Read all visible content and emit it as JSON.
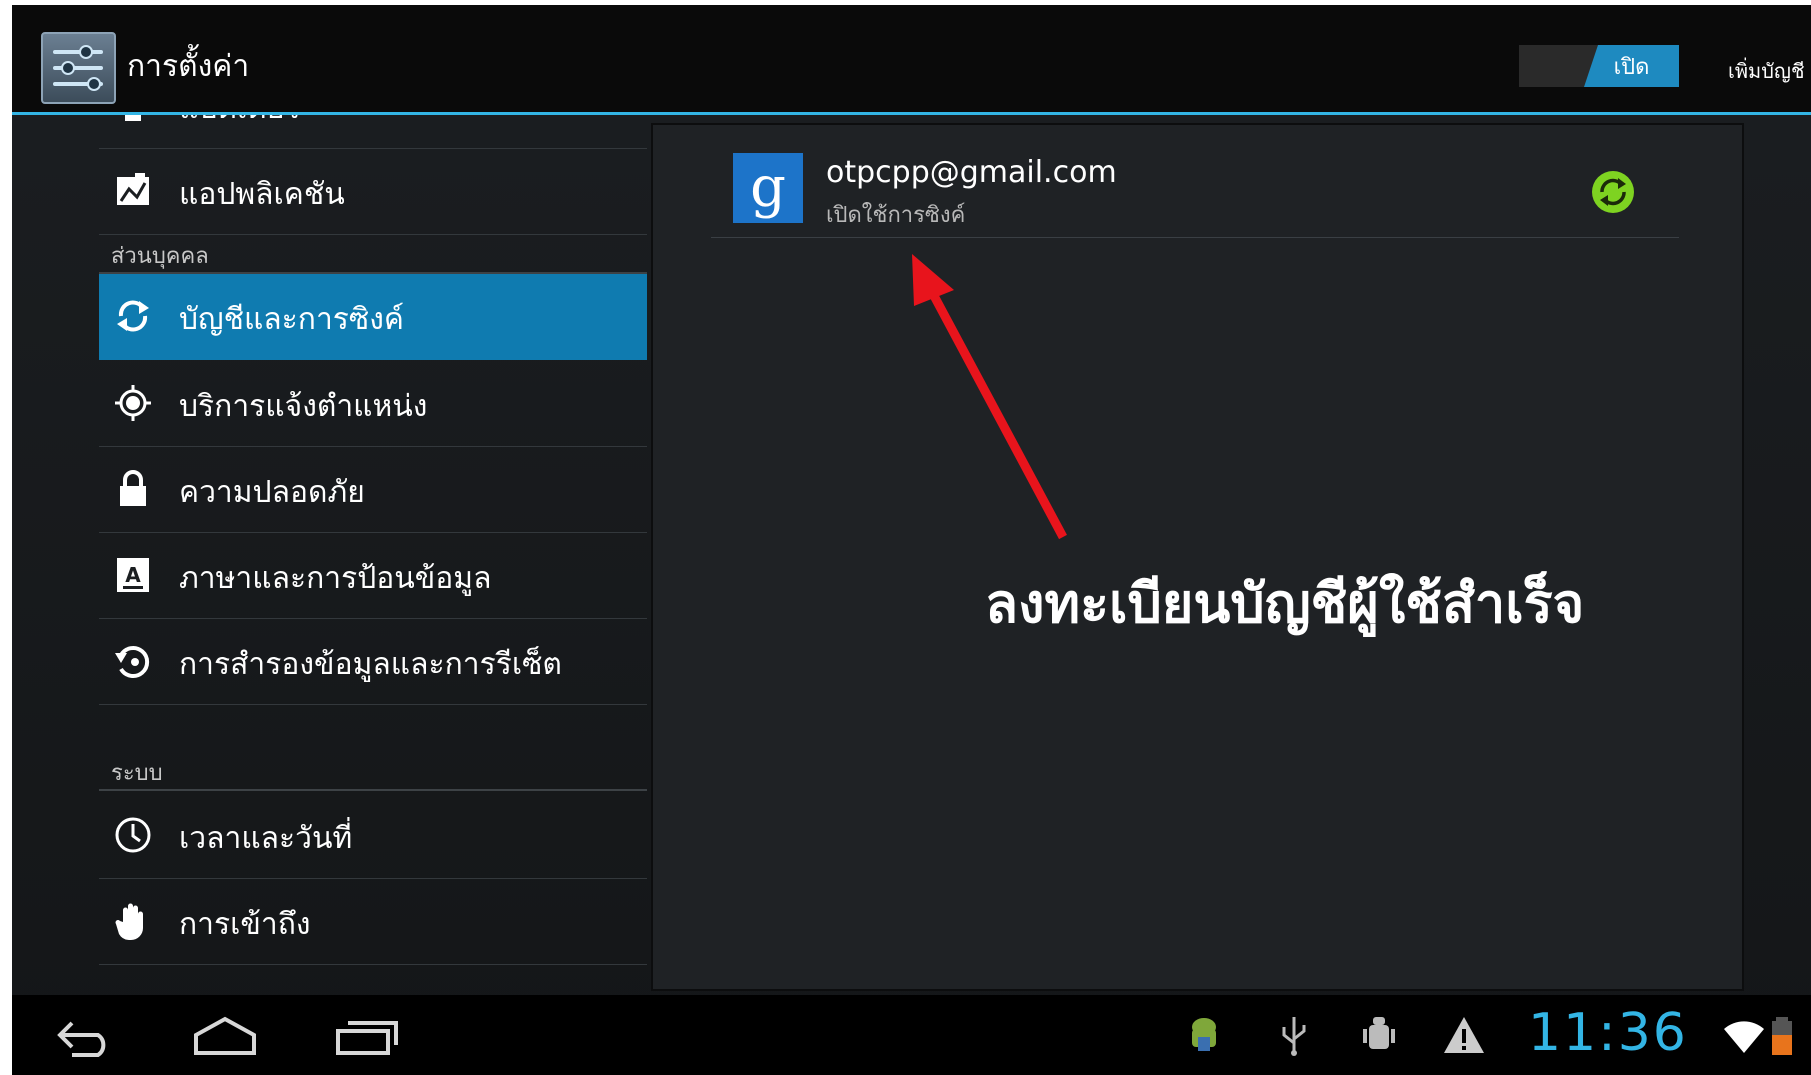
{
  "action_bar": {
    "title": "การตั้งค่า",
    "master_toggle_label": "เปิด",
    "add_account_label": "เพิ่มบัญชี"
  },
  "settings": {
    "partial_top_label": "แบตเตอรี่",
    "items_device": [
      {
        "label": "แอปพลิเคชัน",
        "icon": "apps-icon"
      }
    ],
    "section_personal": "ส่วนบุคคล",
    "items_personal": [
      {
        "label": "บัญชีและการซิงค์",
        "icon": "sync-icon",
        "selected": true
      },
      {
        "label": "บริการแจ้งตำแหน่ง",
        "icon": "location-icon"
      },
      {
        "label": "ความปลอดภัย",
        "icon": "lock-icon"
      },
      {
        "label": "ภาษาและการป้อนข้อมูล",
        "icon": "language-icon"
      },
      {
        "label": "การสำรองข้อมูลและการรีเซ็ต",
        "icon": "backup-icon"
      }
    ],
    "section_system": "ระบบ",
    "items_system": [
      {
        "label": "เวลาและวันที่",
        "icon": "clock-icon"
      },
      {
        "label": "การเข้าถึง",
        "icon": "hand-icon"
      }
    ]
  },
  "account": {
    "email": "otpcpp@gmail.com",
    "status": "เปิดใช้การซิงค์",
    "logo_letter": "g"
  },
  "annotation": {
    "text": "ลงทะเบียนบัญชีผู้ใช้สำเร็จ",
    "arrow_color": "#e8141c"
  },
  "status_bar": {
    "time": "11:36"
  },
  "colors": {
    "accent": "#33b5e5",
    "selected_row": "#0f7bb0",
    "sync_ok": "#7ed321"
  }
}
